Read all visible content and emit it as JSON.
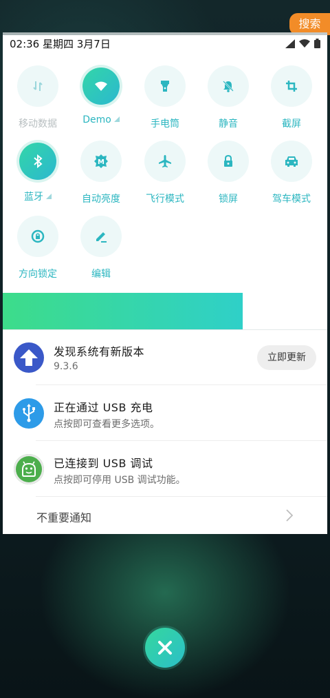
{
  "search_button": "搜索",
  "status_bar": {
    "time_date": "02:36 星期四 3月7日"
  },
  "quick_tiles": [
    {
      "label": "移动数据",
      "icon": "mobile-data-icon",
      "active": false
    },
    {
      "label": "Demo",
      "icon": "wifi-icon",
      "active": true
    },
    {
      "label": "手电筒",
      "icon": "flashlight-icon",
      "active": false
    },
    {
      "label": "静音",
      "icon": "mute-bell-icon",
      "active": false
    },
    {
      "label": "截屏",
      "icon": "screenshot-crop-icon",
      "active": false
    },
    {
      "label": "蓝牙",
      "icon": "bluetooth-icon",
      "active": true
    },
    {
      "label": "自动亮度",
      "icon": "auto-brightness-icon",
      "active": false
    },
    {
      "label": "飞行模式",
      "icon": "airplane-icon",
      "active": false
    },
    {
      "label": "锁屏",
      "icon": "lock-icon",
      "active": false
    },
    {
      "label": "驾车模式",
      "icon": "car-icon",
      "active": false
    },
    {
      "label": "方向锁定",
      "icon": "rotation-lock-icon",
      "active": false
    },
    {
      "label": "编辑",
      "icon": "edit-pencil-icon",
      "active": false
    }
  ],
  "brightness": {
    "level": 0.74
  },
  "notifications": [
    {
      "title": "发现系统有新版本",
      "subtitle": "9.3.6",
      "action": "立即更新",
      "icon": "update-arrow-icon"
    },
    {
      "title": "正在通过  USB  充电",
      "subtitle": "点按即可查看更多选项。",
      "icon": "usb-icon"
    },
    {
      "title": "已连接到  USB  调试",
      "subtitle": "点按即可停用 USB 调试功能。",
      "icon": "android-icon"
    }
  ],
  "unimportant": {
    "label": "不重要通知"
  },
  "colors": {
    "accent": "#2bb6c0",
    "search": "#f28c28"
  }
}
